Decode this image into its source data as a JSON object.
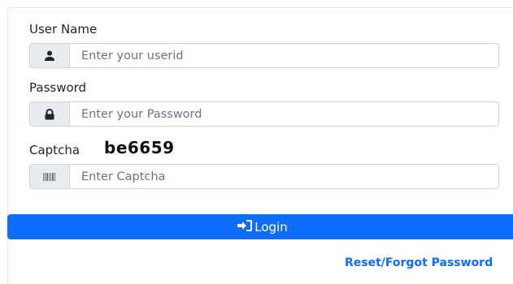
{
  "form": {
    "username_label": "User Name",
    "username_placeholder": "Enter your userid",
    "username_value": "",
    "password_label": "Password",
    "password_placeholder": "Enter your Password",
    "password_value": "",
    "captcha_label": "Captcha",
    "captcha_code": "be6659",
    "captcha_placeholder": "Enter Captcha",
    "captcha_value": "",
    "login_label": "Login",
    "reset_link": "Reset/Forgot Password"
  },
  "icons": {
    "username": "user-icon",
    "password": "lock-icon",
    "captcha": "barcode-icon",
    "login": "sign-in-icon"
  },
  "colors": {
    "primary": "#0d6efd",
    "addon_bg": "#e9ecef",
    "border": "#ced4da"
  }
}
